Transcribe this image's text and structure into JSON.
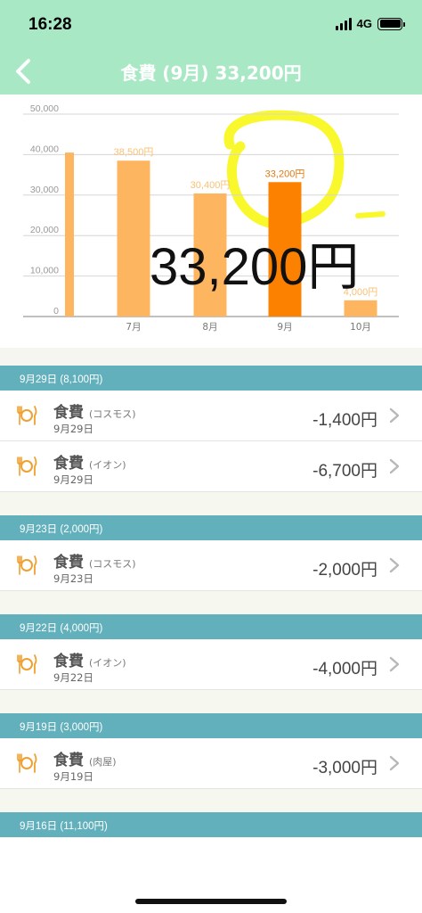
{
  "status_bar": {
    "time": "16:28",
    "network": "4G"
  },
  "nav": {
    "title": "食費 (9月) 33,200円"
  },
  "overlay_text": "33,200円",
  "colors": {
    "header_bg": "#a9e8c4",
    "bar": "#fdb55f",
    "bar_selected": "#fd8100",
    "section": "#63b0bd",
    "highlight": "#f9f82c"
  },
  "chart_data": {
    "type": "bar",
    "categories": [
      "",
      "7月",
      "8月",
      "9月",
      "10月"
    ],
    "values": [
      40500,
      38500,
      30400,
      33200,
      4000
    ],
    "data_labels": [
      "",
      "38,500円",
      "30,400円",
      "33,200円",
      "4,000円"
    ],
    "selected_index": 3,
    "yticks": [
      "0",
      "10,000",
      "20,000",
      "30,000",
      "40,000",
      "50,000"
    ],
    "ylim": [
      0,
      50000
    ],
    "grid": true
  },
  "groups": [
    {
      "header": "9月29日 (8,100円)",
      "items": [
        {
          "category": "食費",
          "shop": "(コスモス)",
          "date": "9月29日",
          "amount": "-1,400円"
        },
        {
          "category": "食費",
          "shop": "(イオン)",
          "date": "9月29日",
          "amount": "-6,700円"
        }
      ]
    },
    {
      "header": "9月23日 (2,000円)",
      "items": [
        {
          "category": "食費",
          "shop": "(コスモス)",
          "date": "9月23日",
          "amount": "-2,000円"
        }
      ]
    },
    {
      "header": "9月22日 (4,000円)",
      "items": [
        {
          "category": "食費",
          "shop": "(イオン)",
          "date": "9月22日",
          "amount": "-4,000円"
        }
      ]
    },
    {
      "header": "9月19日 (3,000円)",
      "items": [
        {
          "category": "食費",
          "shop": "(肉屋)",
          "date": "9月19日",
          "amount": "-3,000円"
        }
      ]
    },
    {
      "header": "9月16日 (11,100円)",
      "items": []
    }
  ]
}
